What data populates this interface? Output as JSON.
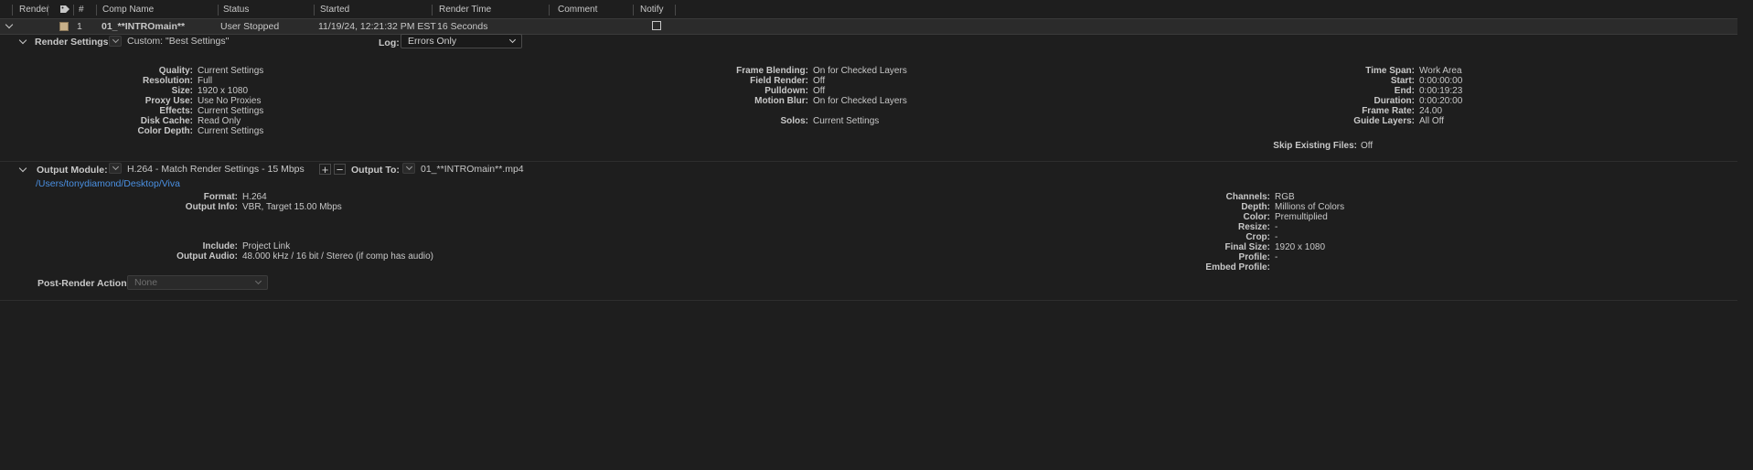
{
  "columns": {
    "render": "Render",
    "num": "#",
    "comp_name": "Comp Name",
    "status": "Status",
    "started": "Started",
    "render_time": "Render Time",
    "comment": "Comment",
    "notify": "Notify"
  },
  "item": {
    "num": "1",
    "comp_name": "01_**INTROmain**",
    "status": "User Stopped",
    "started": "11/19/24, 12:21:32 PM EST",
    "render_time": "16 Seconds"
  },
  "render_settings": {
    "label": "Render Settings:",
    "preset": "Custom: \"Best Settings\"",
    "log_label": "Log:",
    "log_value": "Errors Only",
    "col1": [
      {
        "label": "Quality:",
        "value": "Current Settings"
      },
      {
        "label": "Resolution:",
        "value": "Full"
      },
      {
        "label": "Size:",
        "value": "1920 x 1080"
      },
      {
        "label": "Proxy Use:",
        "value": "Use No Proxies"
      },
      {
        "label": "Effects:",
        "value": "Current Settings"
      },
      {
        "label": "Disk Cache:",
        "value": "Read Only"
      },
      {
        "label": "Color Depth:",
        "value": "Current Settings"
      }
    ],
    "col2": [
      {
        "label": "Frame Blending:",
        "value": "On for Checked Layers"
      },
      {
        "label": "Field Render:",
        "value": "Off"
      },
      {
        "label": "Pulldown:",
        "value": "Off"
      },
      {
        "label": "Motion Blur:",
        "value": "On for Checked Layers"
      },
      {
        "label": "Solos:",
        "value": "Current Settings"
      }
    ],
    "col3": [
      {
        "label": "Time Span:",
        "value": "Work Area"
      },
      {
        "label": "Start:",
        "value": "0:00:00:00"
      },
      {
        "label": "End:",
        "value": "0:00:19:23"
      },
      {
        "label": "Duration:",
        "value": "0:00:20:00"
      },
      {
        "label": "Frame Rate:",
        "value": "24.00"
      },
      {
        "label": "Guide Layers:",
        "value": "All Off"
      }
    ],
    "skip": {
      "label": "Skip Existing Files:",
      "value": "Off"
    }
  },
  "output_module": {
    "label": "Output Module:",
    "preset": "H.264 - Match Render Settings - 15 Mbps",
    "add_symbol": "+",
    "remove_symbol": "−",
    "output_to_label": "Output To:",
    "output_file": "01_**INTROmain**.mp4",
    "path": "/Users/tonydiamond/Desktop/Viva",
    "col1": [
      {
        "label": "Format:",
        "value": "H.264"
      },
      {
        "label": "Output Info:",
        "value": "VBR, Target 15.00 Mbps"
      },
      {
        "label": "Include:",
        "value": "Project Link"
      },
      {
        "label": "Output Audio:",
        "value": "48.000 kHz / 16 bit / Stereo (if comp has audio)"
      }
    ],
    "col2": [
      {
        "label": "Channels:",
        "value": "RGB"
      },
      {
        "label": "Depth:",
        "value": "Millions of Colors"
      },
      {
        "label": "Color:",
        "value": "Premultiplied"
      },
      {
        "label": "Resize:",
        "value": "-"
      },
      {
        "label": "Crop:",
        "value": "-"
      },
      {
        "label": "Final Size:",
        "value": "1920 x 1080"
      },
      {
        "label": "Profile:",
        "value": "-"
      },
      {
        "label": "Embed Profile:",
        "value": ""
      }
    ]
  },
  "post_render": {
    "label": "Post-Render Action:",
    "value": "None"
  },
  "colors": {
    "background": "#1e1e1e",
    "row": "#2b2b2b",
    "link": "#4a90e2",
    "label_swatch": "#c8b08a"
  }
}
